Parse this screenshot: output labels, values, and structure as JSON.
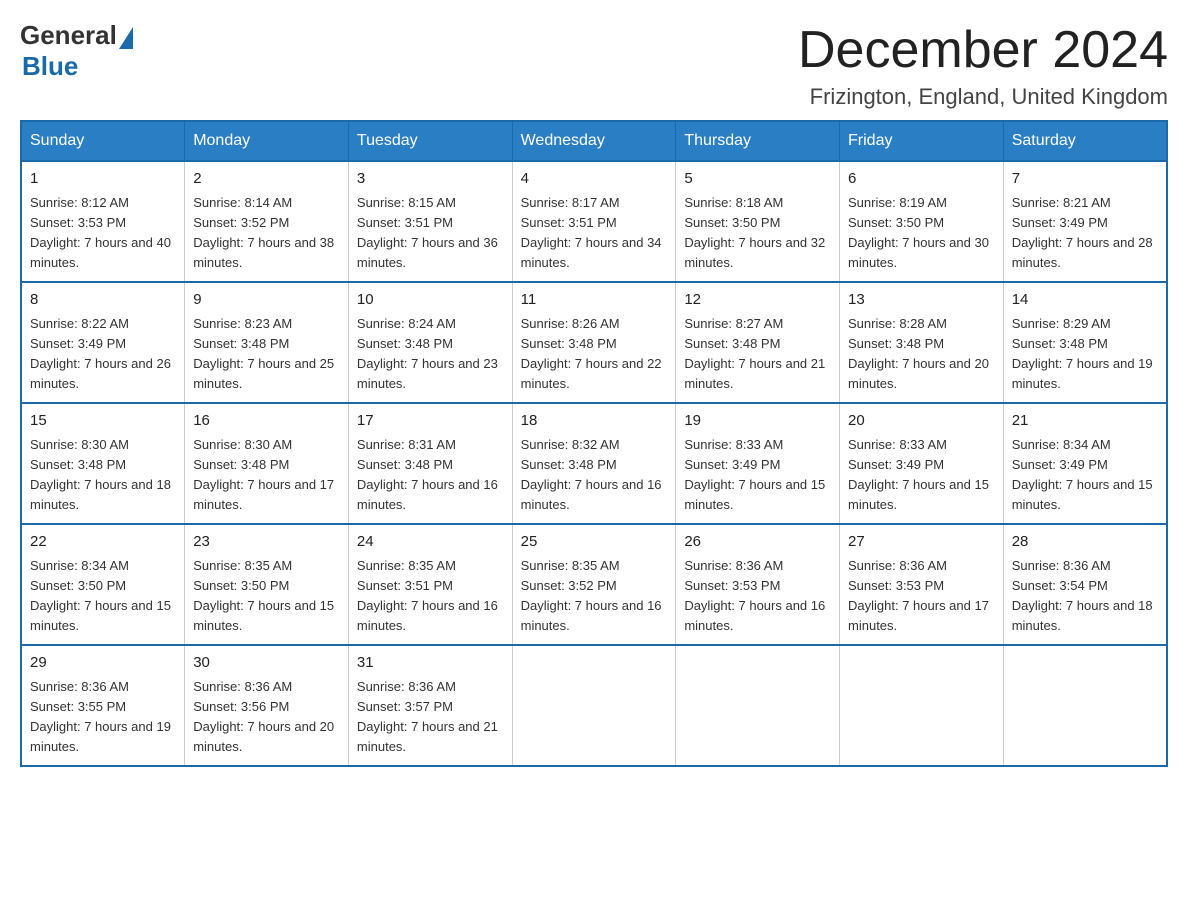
{
  "header": {
    "logo_general": "General",
    "logo_blue": "Blue",
    "month_title": "December 2024",
    "location": "Frizington, England, United Kingdom"
  },
  "weekdays": [
    "Sunday",
    "Monday",
    "Tuesday",
    "Wednesday",
    "Thursday",
    "Friday",
    "Saturday"
  ],
  "weeks": [
    [
      {
        "day": "1",
        "sunrise": "8:12 AM",
        "sunset": "3:53 PM",
        "daylight": "7 hours and 40 minutes."
      },
      {
        "day": "2",
        "sunrise": "8:14 AM",
        "sunset": "3:52 PM",
        "daylight": "7 hours and 38 minutes."
      },
      {
        "day": "3",
        "sunrise": "8:15 AM",
        "sunset": "3:51 PM",
        "daylight": "7 hours and 36 minutes."
      },
      {
        "day": "4",
        "sunrise": "8:17 AM",
        "sunset": "3:51 PM",
        "daylight": "7 hours and 34 minutes."
      },
      {
        "day": "5",
        "sunrise": "8:18 AM",
        "sunset": "3:50 PM",
        "daylight": "7 hours and 32 minutes."
      },
      {
        "day": "6",
        "sunrise": "8:19 AM",
        "sunset": "3:50 PM",
        "daylight": "7 hours and 30 minutes."
      },
      {
        "day": "7",
        "sunrise": "8:21 AM",
        "sunset": "3:49 PM",
        "daylight": "7 hours and 28 minutes."
      }
    ],
    [
      {
        "day": "8",
        "sunrise": "8:22 AM",
        "sunset": "3:49 PM",
        "daylight": "7 hours and 26 minutes."
      },
      {
        "day": "9",
        "sunrise": "8:23 AM",
        "sunset": "3:48 PM",
        "daylight": "7 hours and 25 minutes."
      },
      {
        "day": "10",
        "sunrise": "8:24 AM",
        "sunset": "3:48 PM",
        "daylight": "7 hours and 23 minutes."
      },
      {
        "day": "11",
        "sunrise": "8:26 AM",
        "sunset": "3:48 PM",
        "daylight": "7 hours and 22 minutes."
      },
      {
        "day": "12",
        "sunrise": "8:27 AM",
        "sunset": "3:48 PM",
        "daylight": "7 hours and 21 minutes."
      },
      {
        "day": "13",
        "sunrise": "8:28 AM",
        "sunset": "3:48 PM",
        "daylight": "7 hours and 20 minutes."
      },
      {
        "day": "14",
        "sunrise": "8:29 AM",
        "sunset": "3:48 PM",
        "daylight": "7 hours and 19 minutes."
      }
    ],
    [
      {
        "day": "15",
        "sunrise": "8:30 AM",
        "sunset": "3:48 PM",
        "daylight": "7 hours and 18 minutes."
      },
      {
        "day": "16",
        "sunrise": "8:30 AM",
        "sunset": "3:48 PM",
        "daylight": "7 hours and 17 minutes."
      },
      {
        "day": "17",
        "sunrise": "8:31 AM",
        "sunset": "3:48 PM",
        "daylight": "7 hours and 16 minutes."
      },
      {
        "day": "18",
        "sunrise": "8:32 AM",
        "sunset": "3:48 PM",
        "daylight": "7 hours and 16 minutes."
      },
      {
        "day": "19",
        "sunrise": "8:33 AM",
        "sunset": "3:49 PM",
        "daylight": "7 hours and 15 minutes."
      },
      {
        "day": "20",
        "sunrise": "8:33 AM",
        "sunset": "3:49 PM",
        "daylight": "7 hours and 15 minutes."
      },
      {
        "day": "21",
        "sunrise": "8:34 AM",
        "sunset": "3:49 PM",
        "daylight": "7 hours and 15 minutes."
      }
    ],
    [
      {
        "day": "22",
        "sunrise": "8:34 AM",
        "sunset": "3:50 PM",
        "daylight": "7 hours and 15 minutes."
      },
      {
        "day": "23",
        "sunrise": "8:35 AM",
        "sunset": "3:50 PM",
        "daylight": "7 hours and 15 minutes."
      },
      {
        "day": "24",
        "sunrise": "8:35 AM",
        "sunset": "3:51 PM",
        "daylight": "7 hours and 16 minutes."
      },
      {
        "day": "25",
        "sunrise": "8:35 AM",
        "sunset": "3:52 PM",
        "daylight": "7 hours and 16 minutes."
      },
      {
        "day": "26",
        "sunrise": "8:36 AM",
        "sunset": "3:53 PM",
        "daylight": "7 hours and 16 minutes."
      },
      {
        "day": "27",
        "sunrise": "8:36 AM",
        "sunset": "3:53 PM",
        "daylight": "7 hours and 17 minutes."
      },
      {
        "day": "28",
        "sunrise": "8:36 AM",
        "sunset": "3:54 PM",
        "daylight": "7 hours and 18 minutes."
      }
    ],
    [
      {
        "day": "29",
        "sunrise": "8:36 AM",
        "sunset": "3:55 PM",
        "daylight": "7 hours and 19 minutes."
      },
      {
        "day": "30",
        "sunrise": "8:36 AM",
        "sunset": "3:56 PM",
        "daylight": "7 hours and 20 minutes."
      },
      {
        "day": "31",
        "sunrise": "8:36 AM",
        "sunset": "3:57 PM",
        "daylight": "7 hours and 21 minutes."
      },
      null,
      null,
      null,
      null
    ]
  ]
}
